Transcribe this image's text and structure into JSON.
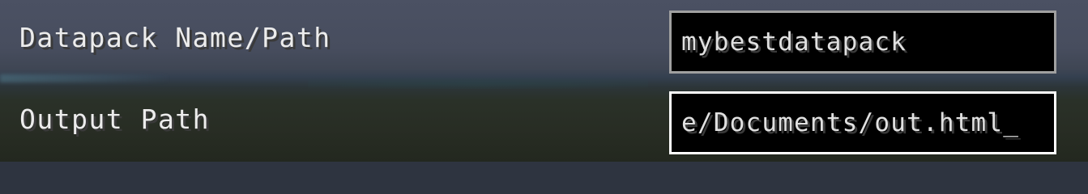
{
  "fields": [
    {
      "label": "Datapack Name/Path",
      "value": "mybestdatapack",
      "focused": false
    },
    {
      "label": "Output Path",
      "value": "e/Documents/out.html_",
      "focused": true
    }
  ],
  "colors": {
    "label_text": "#ececec",
    "field_background": "#000000",
    "field_border_unfocused": "#a0a0a0",
    "field_border_focused": "#ffffff",
    "text_shadow": "#3a3a3a"
  }
}
